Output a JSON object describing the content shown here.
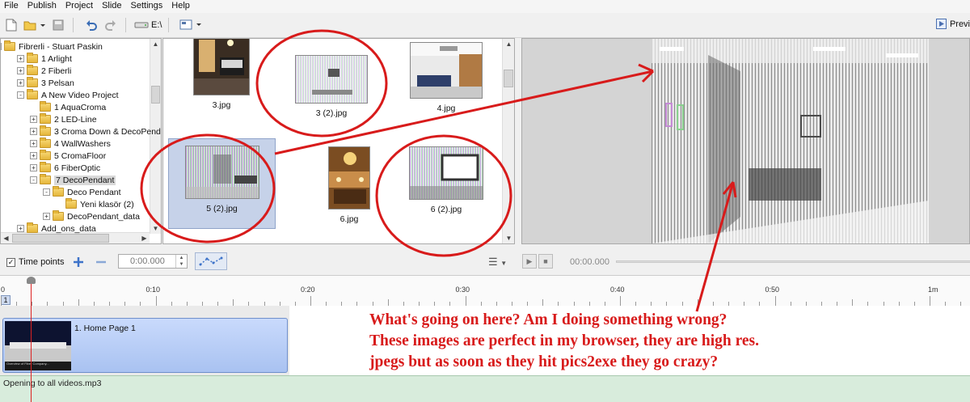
{
  "menu": [
    "File",
    "Publish",
    "Project",
    "Slide",
    "Settings",
    "Help"
  ],
  "toolbar": {
    "drive": "E:\\",
    "preview_label": "Previ",
    "icons": [
      "new-file-icon",
      "open-folder-icon",
      "save-icon",
      "undo-icon",
      "redo-icon",
      "drive-icon",
      "view-mode-icon"
    ]
  },
  "tree": {
    "items": [
      {
        "label": "Fibrerli - Stuart Paskin",
        "level": 0,
        "exp": "-"
      },
      {
        "label": "1 Arlight",
        "level": 1,
        "exp": "+"
      },
      {
        "label": "2 Fiberli",
        "level": 1,
        "exp": "+"
      },
      {
        "label": "3 Pelsan",
        "level": 1,
        "exp": "+"
      },
      {
        "label": "A New Video Project",
        "level": 1,
        "exp": "-"
      },
      {
        "label": "1 AquaCroma",
        "level": 2,
        "exp": ""
      },
      {
        "label": "2 LED-Line",
        "level": 2,
        "exp": "+"
      },
      {
        "label": "3 Croma Down & DecoPend",
        "level": 2,
        "exp": "+"
      },
      {
        "label": "4 WallWashers",
        "level": 2,
        "exp": "+"
      },
      {
        "label": "5 CromaFloor",
        "level": 2,
        "exp": "+"
      },
      {
        "label": "6 FiberOptic",
        "level": 2,
        "exp": "+"
      },
      {
        "label": "7 DecoPendant",
        "level": 2,
        "exp": "-",
        "selected": true
      },
      {
        "label": "Deco Pendant",
        "level": 3,
        "exp": "-"
      },
      {
        "label": "Yeni klasör (2)",
        "level": 4,
        "exp": ""
      },
      {
        "label": "DecoPendant_data",
        "level": 3,
        "exp": "+"
      },
      {
        "label": "Add_ons_data",
        "level": 1,
        "exp": "+"
      }
    ]
  },
  "thumbnails": [
    {
      "caption": "3.jpg",
      "selected": false
    },
    {
      "caption": "3 (2).jpg",
      "selected": false
    },
    {
      "caption": "4.jpg",
      "selected": false
    },
    {
      "caption": "5 (2).jpg",
      "selected": true
    },
    {
      "caption": "6.jpg",
      "selected": false
    },
    {
      "caption": "6 (2).jpg",
      "selected": false
    }
  ],
  "timepoints": {
    "checkbox_label": "Time points",
    "checked": true,
    "time_value": "0:00.000",
    "playback_time": "00:00.000"
  },
  "ruler": {
    "labels": [
      "0",
      "0:10",
      "0:20",
      "0:30",
      "0:40",
      "0:50",
      "1m"
    ],
    "slide_number": "1"
  },
  "clip": {
    "label": "1. Home Page 1",
    "thumb_text": "Overview of Fiber Company..."
  },
  "audio": {
    "label": "Opening to all videos.mp3"
  },
  "annotation": {
    "lines": [
      "What's going on here? Am I doing something wrong?",
      "These images are perfect in my browser, they are high res.",
      "jpegs but as soon as they hit pics2exe they go crazy?"
    ],
    "color": "#d81b1b"
  }
}
